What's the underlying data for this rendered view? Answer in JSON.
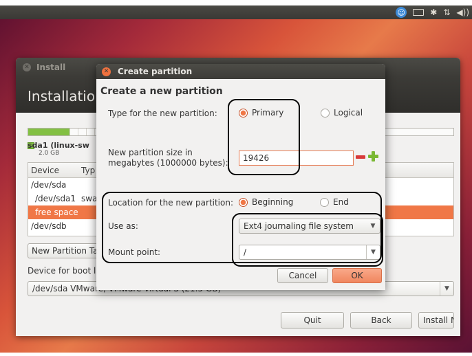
{
  "topbar": {
    "accessibility_icon_glyph": "⚲",
    "bluetooth_glyph": "✱",
    "network_glyph": "⇅",
    "volume_glyph": "◀))"
  },
  "install_window": {
    "title": "Install",
    "header": "Installatio",
    "disk_label": "sda1 (linux-sw",
    "disk_size": "2.0 GB",
    "table": {
      "columns": [
        "Device",
        "Typ"
      ],
      "rows": [
        {
          "device": "/dev/sda",
          "type": ""
        },
        {
          "device": "/dev/sda1",
          "type": "swa"
        },
        {
          "device": "free space",
          "type": "",
          "selected": true
        },
        {
          "device": "/dev/sdb",
          "type": ""
        }
      ]
    },
    "new_partition_table_button": "New Partition Ta",
    "boot_loader_label": "Device for boot l",
    "boot_loader_value": "/dev/sda  VMware, VMware Virtual S (21.5 GB)",
    "quit_button": "Quit",
    "back_button": "Back",
    "install_now_button": "Install Now"
  },
  "dialog": {
    "title": "Create partition",
    "header": "Create a new partition",
    "type_label": "Type for the new partition:",
    "type_options": [
      "Primary",
      "Logical"
    ],
    "type_selected": "Primary",
    "size_label_line1": "New partition size in",
    "size_label_line2": "megabytes (1000000 bytes):",
    "size_value": "19426",
    "location_label": "Location for the new partition:",
    "location_options": [
      "Beginning",
      "End"
    ],
    "location_selected": "Beginning",
    "use_as_label": "Use as:",
    "use_as_value": "Ext4 journaling file system",
    "mount_point_label": "Mount point:",
    "mount_point_value": "/",
    "cancel_button": "Cancel",
    "ok_button": "OK"
  },
  "colors": {
    "accent": "#f07746",
    "selection_row": "#f07746",
    "disk_used": "#83c043"
  }
}
